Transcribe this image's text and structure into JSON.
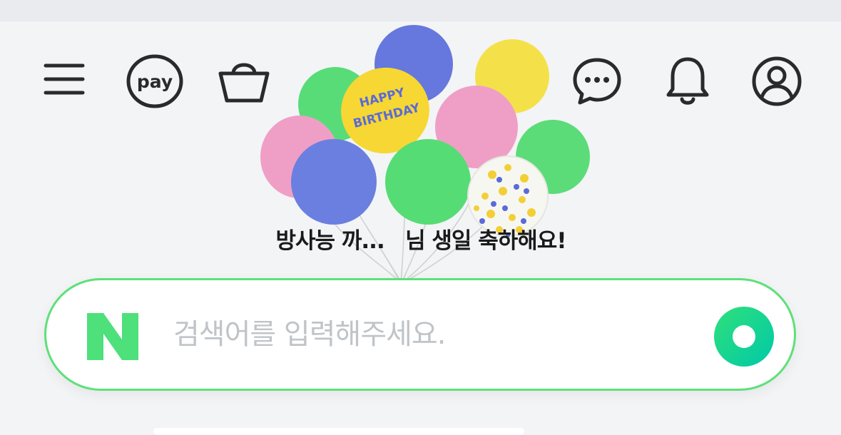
{
  "header": {
    "menu_icon": "hamburger-menu-icon",
    "pay_label": "pay",
    "shopping_icon": "shopping-bag-icon",
    "talk_icon": "chat-bubble-icon",
    "notification_icon": "bell-icon",
    "profile_icon": "user-circle-icon"
  },
  "banner": {
    "balloon_label": "HAPPY BIRTHDAY",
    "greeting": "방사능 까...   님 생일 축하해요!"
  },
  "search": {
    "logo_letter": "N",
    "placeholder": "검색어를 입력해주세요.",
    "value": ""
  },
  "colors": {
    "brand_green": "#03c75a",
    "logo_green": "#4ee07a",
    "search_border": "#5ee07a"
  }
}
